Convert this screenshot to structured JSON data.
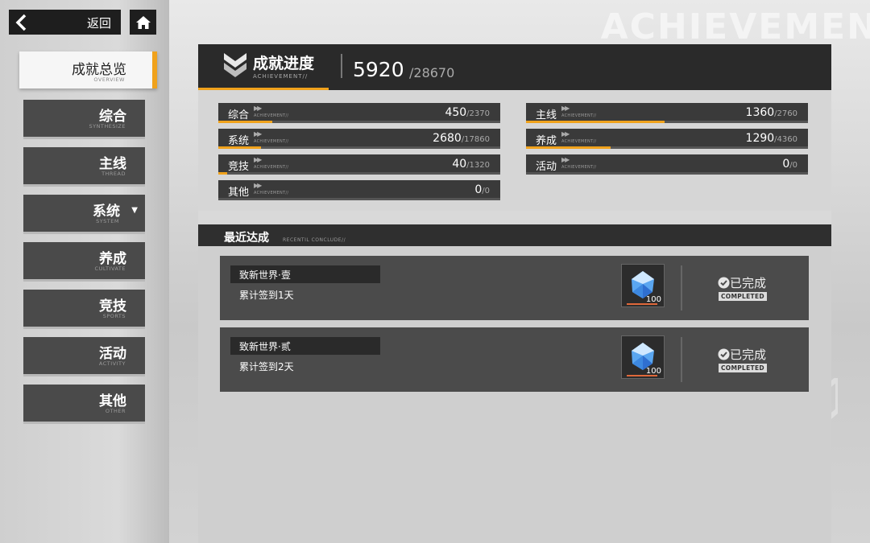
{
  "header": {
    "back_label": "返回",
    "watermark": "ACHIEVEMEN"
  },
  "sidebar": {
    "active": {
      "cn": "成就总览",
      "en": "OVERVIEW"
    },
    "items": [
      {
        "cn": "综合",
        "en": "SYNTHESIZE"
      },
      {
        "cn": "主线",
        "en": "THREAD"
      },
      {
        "cn": "系统",
        "en": "SYSTEM",
        "caret": "▼"
      },
      {
        "cn": "养成",
        "en": "CULTIVATE"
      },
      {
        "cn": "竞技",
        "en": "SPORTS"
      },
      {
        "cn": "活动",
        "en": "ACTIVITY"
      },
      {
        "cn": "其他",
        "en": "OTHER"
      }
    ]
  },
  "progress": {
    "title": "成就进度",
    "subtitle": "ACHIEVEMENT//",
    "score": "5920",
    "total": "/28670"
  },
  "stats": [
    {
      "name": "综合",
      "tag": "ACHIEVEMENT//",
      "value": "450",
      "total": "/2370",
      "fraction": 0.19
    },
    {
      "name": "主线",
      "tag": "ACHIEVEMENT//",
      "value": "1360",
      "total": "/2760",
      "fraction": 0.49
    },
    {
      "name": "系统",
      "tag": "ACHIEVEMENT//",
      "value": "2680",
      "total": "/17860",
      "fraction": 0.15
    },
    {
      "name": "养成",
      "tag": "ACHIEVEMENT//",
      "value": "1290",
      "total": "/4360",
      "fraction": 0.3
    },
    {
      "name": "竞技",
      "tag": "ACHIEVEMENT//",
      "value": "40",
      "total": "/1320",
      "fraction": 0.03
    },
    {
      "name": "活动",
      "tag": "ACHIEVEMENT//",
      "value": "0",
      "total": "/0",
      "fraction": 0
    },
    {
      "name": "其他",
      "tag": "ACHIEVEMENT//",
      "value": "0",
      "total": "/0",
      "fraction": 0
    }
  ],
  "recent": {
    "title": "最近达成",
    "subtitle": "RECENTIL CONCLUDE//",
    "items": [
      {
        "name": "致新世界·壹",
        "desc": "累计签到1天",
        "reward_qty": "100",
        "status": "已完成",
        "status_en": "COMPLETED"
      },
      {
        "name": "致新世界·贰",
        "desc": "累计签到2天",
        "reward_qty": "100",
        "status": "已完成",
        "status_en": "COMPLETED"
      }
    ]
  },
  "colors": {
    "accent": "#f0a21c",
    "panel_dark": "#2a2a2a",
    "qty_bar": "#e0683a"
  }
}
